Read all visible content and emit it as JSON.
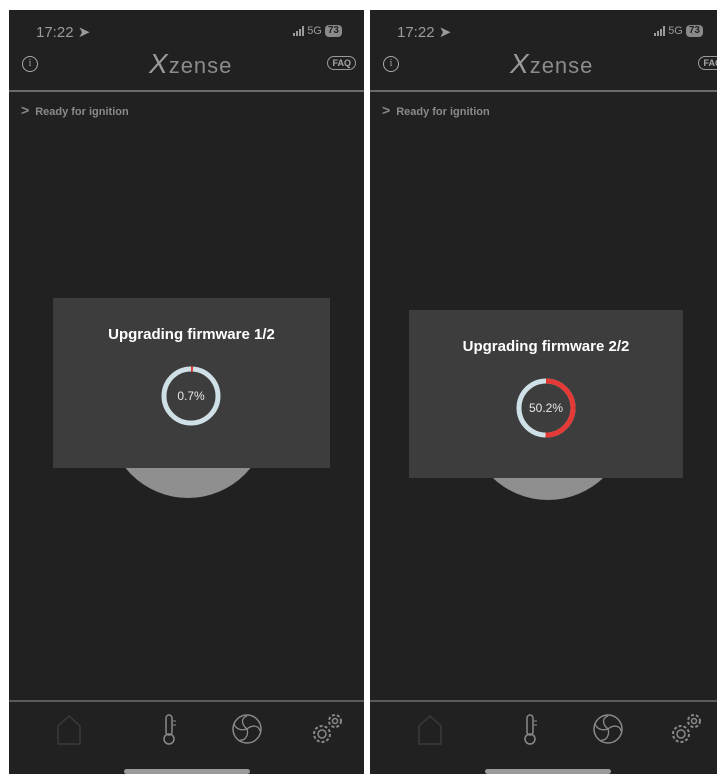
{
  "left": {
    "status": {
      "time": "17:22",
      "network": "5G",
      "battery": "73"
    },
    "header": {
      "logo": "zense",
      "logo_x": "X",
      "faq": "FAQ"
    },
    "status_line": "Ready for ignition",
    "modal": {
      "title": "Upgrading firmware 1/2",
      "percent_label": "0.7%",
      "progress": 0.007
    }
  },
  "right": {
    "status": {
      "time": "17:22",
      "network": "5G",
      "battery": "73"
    },
    "header": {
      "logo": "zense",
      "logo_x": "X",
      "faq": "FAQ"
    },
    "status_line": "Ready for ignition",
    "modal": {
      "title": "Upgrading firmware 2/2",
      "percent_label": "50.2%",
      "progress": 0.502
    }
  },
  "tabs": [
    "home-icon",
    "thermometer-icon",
    "fan-icon",
    "settings-gears-icon"
  ],
  "colors": {
    "background": "#212121",
    "modal": "#3d3d3d",
    "progress": "#e53935",
    "track": "#cfe0e6"
  }
}
